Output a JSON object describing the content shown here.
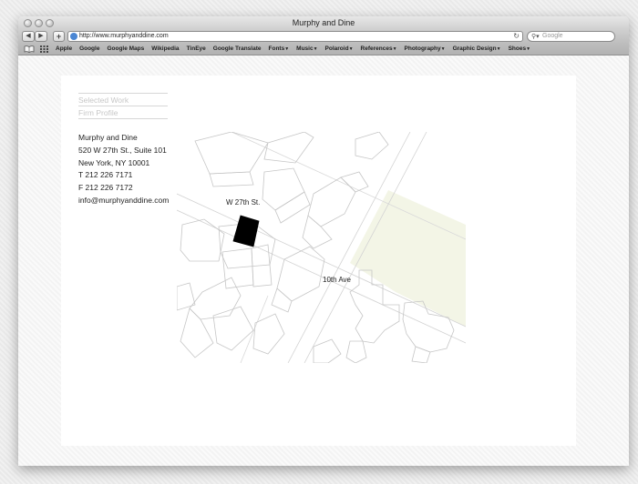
{
  "window": {
    "title": "Murphy and Dine"
  },
  "toolbar": {
    "back": "◀",
    "forward": "▶",
    "add": "+",
    "url": "http://www.murphyanddine.com",
    "reload": "↻",
    "search_placeholder": "Google"
  },
  "bookmarks": [
    {
      "label": "Apple",
      "menu": false
    },
    {
      "label": "Google",
      "menu": false
    },
    {
      "label": "Google Maps",
      "menu": false
    },
    {
      "label": "Wikipedia",
      "menu": false
    },
    {
      "label": "TinEye",
      "menu": false
    },
    {
      "label": "Google Translate",
      "menu": false
    },
    {
      "label": "Fonts",
      "menu": true
    },
    {
      "label": "Music",
      "menu": true
    },
    {
      "label": "Polaroid",
      "menu": true
    },
    {
      "label": "References",
      "menu": true
    },
    {
      "label": "Photography",
      "menu": true
    },
    {
      "label": "Graphic Design",
      "menu": true
    },
    {
      "label": "Shoes",
      "menu": true
    }
  ],
  "site": {
    "nav": [
      "Selected Work",
      "Firm Profile"
    ],
    "address": [
      "Murphy and Dine",
      "520 W 27th St., Suite 101",
      "New York, NY 10001",
      "T 212 226 7171",
      "F 212 226 7172",
      "info@murphyanddine.com"
    ],
    "map": {
      "street_label": "W 27th St.",
      "avenue_label": "10th Ave"
    }
  },
  "icons": {
    "bookmarks": "book-icon",
    "grid": "grid-icon",
    "globe": "globe-icon",
    "search": "magnifier-icon"
  }
}
